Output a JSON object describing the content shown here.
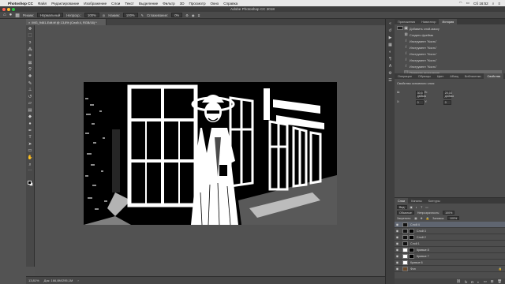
{
  "menubar": {
    "app": "Photoshop CC",
    "items": [
      "Файл",
      "Редактирование",
      "Изображение",
      "Слои",
      "Текст",
      "Выделение",
      "Фильтр",
      "3D",
      "Просмотр",
      "Окно",
      "Справка"
    ],
    "clock": "Сб 16:52"
  },
  "window": {
    "title": "Adobe Photoshop CC 2018"
  },
  "options": {
    "mode_label": "Режим:",
    "mode_value": "Нормальный",
    "opacity_label": "Непрозр.:",
    "opacity_value": "100%",
    "flow_label": "Нажим:",
    "flow_value": "100%",
    "smoothing_label": "Сглаживание:",
    "smoothing_value": "0%"
  },
  "document": {
    "tab_label": "IMG_9461-Edit.tif @ 13,8% (Слой 4, RGB/16) *",
    "zoom": "13,81%",
    "doc_info": "Док: 166,8M/295,1M"
  },
  "panels": {
    "top_tabs": [
      "Приложения",
      "Навигатор",
      "История"
    ],
    "history_items": [
      "Добавить слой-маску",
      "Создать фреймы",
      "Инструмент \"Кисть\"",
      "Инструмент \"Кисть\"",
      "Инструмент \"Кисть\"",
      "Инструмент \"Кисть\"",
      "Инструмент \"Кисть\"",
      "Отменить выделение"
    ],
    "mid_tabs": [
      "Операции",
      "Образцы",
      "Цвет",
      "Абзац",
      "Библиотеки",
      "Свойства"
    ],
    "properties_title": "Свойства основного слоя",
    "properties": [
      {
        "label": "Ш:",
        "value": "30,5 дюйма"
      },
      {
        "label": "В:",
        "value": "20,33 дюйма"
      },
      {
        "label": "X:",
        "value": "0"
      },
      {
        "label": "Y:",
        "value": "0"
      }
    ],
    "layers_tabs": [
      "Слои",
      "Каналы",
      "Контуры"
    ],
    "layers_filter": "Вид",
    "layers_blend": "Обычные",
    "layers_opacity_label": "Непрозрачность:",
    "layers_opacity": "100%",
    "layers_lock_label": "Закрепить:",
    "layers_fill_label": "Заливка:",
    "layers_fill": "100%",
    "layers": [
      {
        "name": "Слой 4",
        "thumb": "dark",
        "mask": false,
        "selected": true
      },
      {
        "name": "Слой 3",
        "thumb": "dark",
        "mask": true,
        "selected": false
      },
      {
        "name": "Слой 2",
        "thumb": "dark",
        "mask": true,
        "selected": false
      },
      {
        "name": "Слой 1",
        "thumb": "dark",
        "mask": false,
        "selected": false
      },
      {
        "name": "Кривые 8",
        "thumb": "light",
        "mask": true,
        "selected": false
      },
      {
        "name": "Кривые 7",
        "thumb": "light",
        "mask": true,
        "selected": false
      },
      {
        "name": "Кривые 6",
        "thumb": "light",
        "mask": false,
        "selected": false
      },
      {
        "name": "Фон",
        "thumb": "dark",
        "mask": false,
        "selected": false
      }
    ]
  },
  "colors": {
    "panel_bg": "#4d4d4d",
    "canvas_bg": "#525252",
    "selected_layer": "#5f6570"
  }
}
